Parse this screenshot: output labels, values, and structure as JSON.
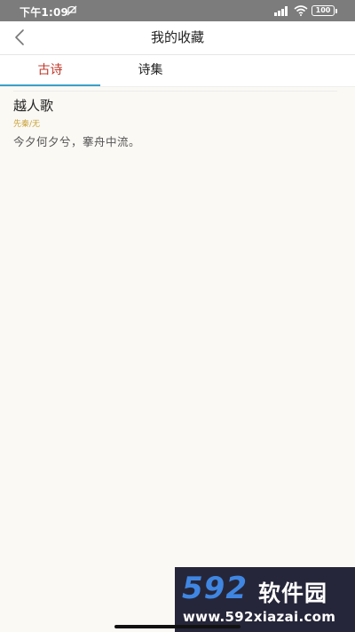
{
  "status_bar": {
    "time": "下午1:09",
    "battery": "100",
    "icons": [
      "do-not-disturb-icon",
      "signal-icon",
      "wifi-icon",
      "battery-icon"
    ]
  },
  "nav": {
    "title": "我的收藏",
    "back_icon": "chevron-left-icon"
  },
  "tabs": [
    {
      "label": "古诗",
      "active": true
    },
    {
      "label": "诗集",
      "active": false
    }
  ],
  "colors": {
    "active_tab": "#c0392b",
    "tab_indicator": "#3aa0c8",
    "meta_text": "#c8a23a",
    "background": "#fbf9f4"
  },
  "favorites": [
    {
      "title": "越人歌",
      "meta": "先秦/无",
      "excerpt": "今夕何夕兮，搴舟中流。"
    }
  ],
  "watermark": {
    "logo": "592",
    "brand": "软件园",
    "url": "www.592xiazai.com"
  }
}
